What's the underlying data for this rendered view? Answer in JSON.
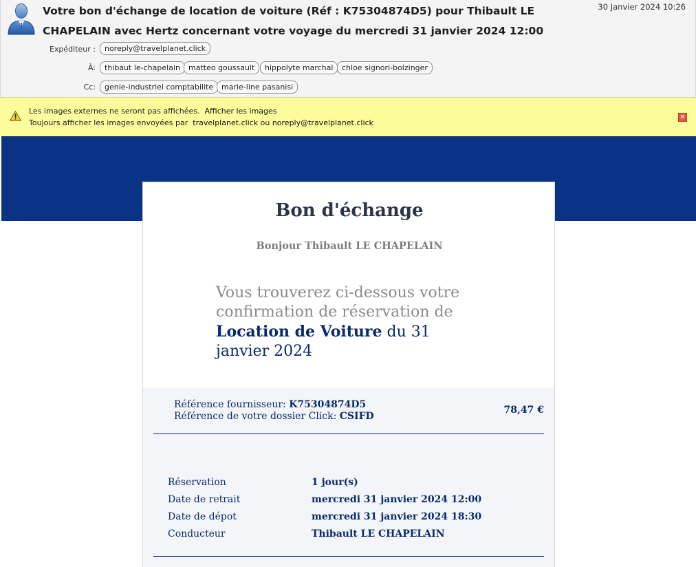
{
  "header": {
    "subject": "Votre bon d'échange de location de voiture (Réf : K75304874D5) pour Thibault LE CHAPELAIN avec Hertz concernant votre voyage du mercredi 31 janvier 2024 12:00",
    "date": "30 Janvier 2024 10:26",
    "from_label": "Expéditeur :",
    "from": "noreply@travelplanet.click",
    "to_label": "À:",
    "to": [
      "thibaut le-chapelain",
      "matteo goussault",
      "hippolyte marchal",
      "chloe signori-bolzinger"
    ],
    "cc_label": "Cc:",
    "cc": [
      "genie-industriel comptabilite",
      "marie-line pasanisi"
    ]
  },
  "notice": {
    "line1_text": "Les images externes ne seront pas affichées.",
    "line1_link": "Afficher les images",
    "line2_text": "Toujours afficher les images envoyées par",
    "line2_link1": "travelplanet.click",
    "line2_sep": "ou",
    "line2_link2": "noreply@travelplanet.click"
  },
  "mail": {
    "title": "Bon d'échange",
    "greeting": "Bonjour Thibault LE CHAPELAIN",
    "intro_pre": "Vous trouverez ci-dessous votre confirmation de réservation de",
    "intro_strong": "Location de Voiture",
    "intro_post": "du 31 janvier 2024",
    "ref_supplier_label": "Référence fournisseur:",
    "ref_supplier_value": "K75304874D5",
    "ref_click_label": "Référence de votre dossier Click:",
    "ref_click_value": "CSIFD",
    "price": "78,47 €",
    "details": [
      {
        "label": "Réservation",
        "value": "1 jour(s)"
      },
      {
        "label": "Date de retrait",
        "value": "mercredi 31 janvier 2024 12:00"
      },
      {
        "label": "Date de dépot",
        "value": "mercredi 31 janvier 2024 18:30"
      },
      {
        "label": "Conducteur",
        "value": "Thibault LE CHAPELAIN"
      }
    ]
  },
  "colors": {
    "navy": "#0b3385",
    "notice_bg": "#fcfc9d",
    "text_navy": "#0a2a6b"
  },
  "icons": {
    "avatar": "user-avatar-icon",
    "warning": "warning-triangle-icon",
    "close": "close-icon"
  }
}
